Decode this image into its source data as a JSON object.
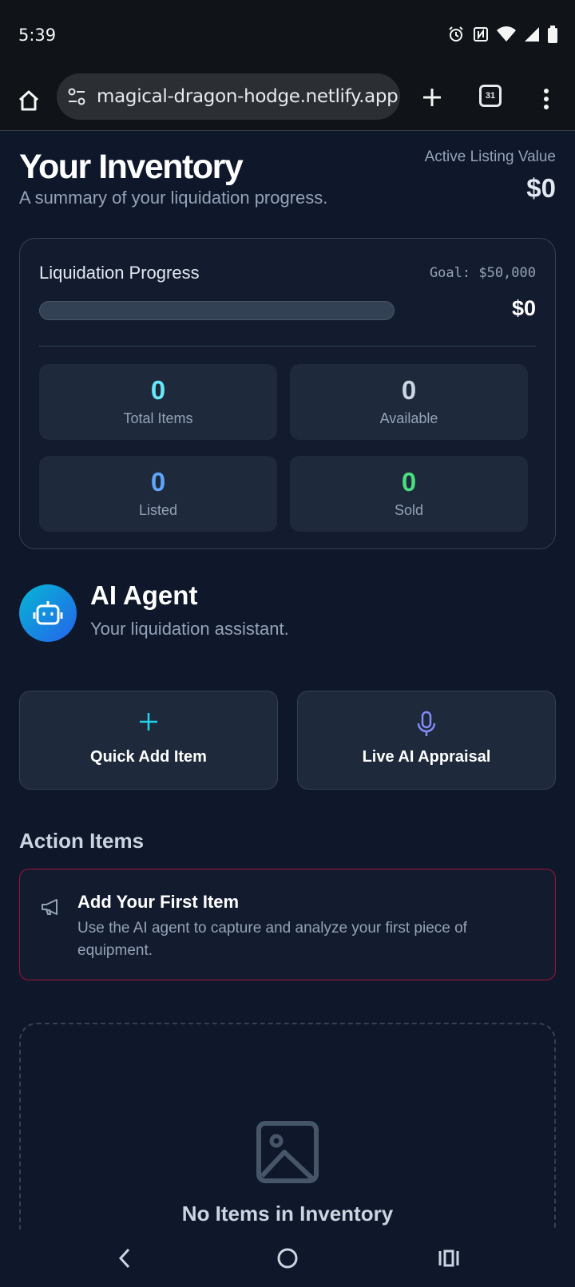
{
  "status_bar": {
    "time": "5:39"
  },
  "browser": {
    "url": "magical-dragon-hodge.netlify.app",
    "tab_count": "31"
  },
  "header": {
    "title": "Your Inventory",
    "subtitle": "A summary of your liquidation progress.",
    "listing_value_label": "Active Listing Value",
    "listing_value": "$0"
  },
  "progress": {
    "label": "Liquidation Progress",
    "goal": "Goal: $50,000",
    "amount": "$0",
    "fraction": 0
  },
  "stats": [
    {
      "value": "0",
      "label": "Total Items",
      "color": "#67e8f9"
    },
    {
      "value": "0",
      "label": "Available",
      "color": "#cbd5e1"
    },
    {
      "value": "0",
      "label": "Listed",
      "color": "#60a5fa"
    },
    {
      "value": "0",
      "label": "Sold",
      "color": "#4ade80"
    }
  ],
  "agent": {
    "title": "AI Agent",
    "subtitle": "Your liquidation assistant.",
    "icon": "robot-icon"
  },
  "actions": [
    {
      "label": "Quick Add Item",
      "icon": "plus-icon",
      "color": "#22d3ee"
    },
    {
      "label": "Live AI Appraisal",
      "icon": "microphone-icon",
      "color": "#818cf8"
    }
  ],
  "action_items": {
    "section_title": "Action Items",
    "items": [
      {
        "title": "Add Your First Item",
        "description": "Use the AI agent to capture and analyze your first piece of equipment.",
        "icon": "megaphone-icon"
      }
    ]
  },
  "empty_state": {
    "title": "No Items in Inventory",
    "icon": "image-icon"
  },
  "colors": {
    "background": "#0f172a",
    "card": "#131c2e",
    "tile": "#1e293b",
    "accent": "#22d3ee",
    "alert_border": "#9f1239"
  }
}
